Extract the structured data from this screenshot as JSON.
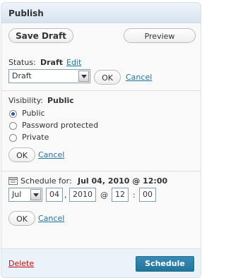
{
  "panel": {
    "title": "Publish",
    "save_draft_label": "Save Draft",
    "preview_label": "Preview"
  },
  "status": {
    "label": "Status:",
    "value": "Draft",
    "edit_link": "Edit",
    "select_value": "Draft",
    "ok_label": "OK",
    "cancel_label": "Cancel"
  },
  "visibility": {
    "label": "Visibility:",
    "value": "Public",
    "options": [
      {
        "label": "Public",
        "checked": true
      },
      {
        "label": "Password protected",
        "checked": false
      },
      {
        "label": "Private",
        "checked": false
      }
    ],
    "ok_label": "OK",
    "cancel_label": "Cancel"
  },
  "schedule": {
    "label": "Schedule for:",
    "value": "Jul 04, 2010 @ 12:00",
    "month": "Jul",
    "day": "04",
    "year": "2010",
    "at_symbol": "@",
    "hour": "12",
    "colon": ":",
    "minute": "00",
    "comma": ",",
    "ok_label": "OK",
    "cancel_label": "Cancel"
  },
  "footer": {
    "delete_label": "Delete",
    "schedule_label": "Schedule"
  },
  "colors": {
    "link": "#21759b",
    "delete": "#bc0b0b",
    "primary_button": "#21759b"
  }
}
